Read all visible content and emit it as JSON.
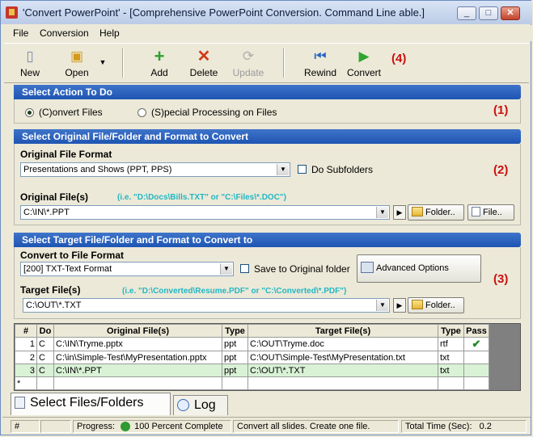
{
  "window": {
    "title": "'Convert PowerPoint' - [Comprehensive PowerPoint Conversion. Command Line able.]"
  },
  "menu": [
    "File",
    "Conversion",
    "Help"
  ],
  "toolbar": {
    "new": "New",
    "open": "Open",
    "add": "Add",
    "delete": "Delete",
    "update": "Update",
    "rewind": "Rewind",
    "convert": "Convert",
    "marker": "(4)"
  },
  "section1": {
    "header": "Select Action To Do",
    "radio_convert": "(C)onvert Files",
    "radio_special": "(S)pecial Processing on Files",
    "marker": "(1)"
  },
  "section2": {
    "header": "Select Original File/Folder and Format to Convert",
    "format_label": "Original File Format",
    "format_value": "Presentations and Shows (PPT, PPS)",
    "subfolders": "Do Subfolders",
    "files_label": "Original File(s)",
    "files_hint": "(i.e. \"D:\\Docs\\Bills.TXT\"  or \"C:\\Files\\*.DOC\")",
    "files_value": "C:\\IN\\*.PPT",
    "folder_btn": "Folder..",
    "file_btn": "File..",
    "marker": "(2)"
  },
  "section3": {
    "header": "Select Target File/Folder and Format to Convert to",
    "format_label": "Convert to File Format",
    "format_value": "[200] TXT-Text Format",
    "save_original": "Save to Original folder",
    "advanced": "Advanced Options",
    "target_label": "Target File(s)",
    "target_hint": "(i.e. \"D:\\Converted\\Resume.PDF\" or \"C:\\Converted\\*.PDF\")",
    "target_value": "C:\\OUT\\*.TXT",
    "folder_btn": "Folder..",
    "marker": "(3)"
  },
  "grid": {
    "headers": [
      "#",
      "Do",
      "Original File(s)",
      "Type",
      "Target File(s)",
      "Type",
      "Pass"
    ],
    "rows": [
      [
        "1",
        "C",
        "C:\\IN\\Tryme.pptx",
        "ppt",
        "C:\\OUT\\Tryme.doc",
        "rtf",
        "✔"
      ],
      [
        "2",
        "C",
        "C:\\in\\Simple-Test\\MyPresentation.pptx",
        "ppt",
        "C:\\OUT\\Simple-Test\\MyPresentation.txt",
        "txt",
        ""
      ],
      [
        "3",
        "C",
        "C:\\IN\\*.PPT",
        "ppt",
        "C:\\OUT\\*.TXT",
        "txt",
        ""
      ]
    ],
    "new_row": "*"
  },
  "tabs": {
    "files": "Select Files/Folders",
    "log": "Log"
  },
  "status": {
    "hash": "#",
    "progress_label": "Progress:",
    "progress_text": "100 Percent Complete",
    "message": "Convert all slides. Create one file.",
    "time_label": "Total Time (Sec):",
    "time_value": "0.2"
  }
}
